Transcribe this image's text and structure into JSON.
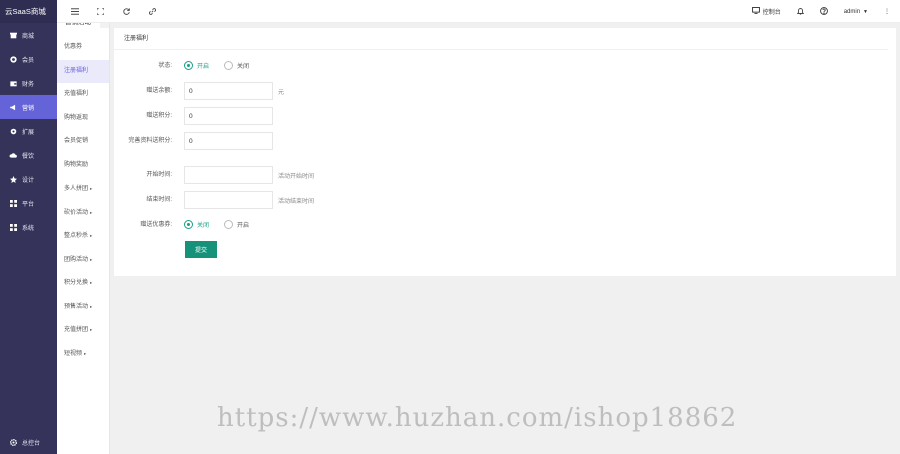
{
  "brand": "云SaaS商城",
  "sidebar": {
    "items": [
      {
        "label": "商城",
        "icon": "shop-icon"
      },
      {
        "label": "会员",
        "icon": "member-icon"
      },
      {
        "label": "财务",
        "icon": "wallet-icon"
      },
      {
        "label": "营销",
        "icon": "megaphone-icon"
      },
      {
        "label": "扩展",
        "icon": "puzzle-icon"
      },
      {
        "label": "餐饮",
        "icon": "cloud-icon"
      },
      {
        "label": "设计",
        "icon": "brush-icon"
      },
      {
        "label": "平台",
        "icon": "grid-icon"
      },
      {
        "label": "系统",
        "icon": "grid-icon"
      }
    ],
    "bottom": {
      "label": "总控台",
      "icon": "gear-icon"
    }
  },
  "submenu": {
    "title": "营销活动",
    "collapse": "«",
    "items": [
      {
        "label": "优惠券",
        "arrow": ""
      },
      {
        "label": "注册福利",
        "arrow": ""
      },
      {
        "label": "充值福利",
        "arrow": ""
      },
      {
        "label": "购物返现",
        "arrow": ""
      },
      {
        "label": "会员促销",
        "arrow": ""
      },
      {
        "label": "购物奖励",
        "arrow": ""
      },
      {
        "label": "多人拼团",
        "arrow": "▸"
      },
      {
        "label": "砍价活动",
        "arrow": "▸"
      },
      {
        "label": "整点秒杀",
        "arrow": "▸"
      },
      {
        "label": "团购活动",
        "arrow": "▸"
      },
      {
        "label": "积分兑换",
        "arrow": "▸"
      },
      {
        "label": "预售活动",
        "arrow": "▸"
      },
      {
        "label": "充值拼团",
        "arrow": "▸"
      },
      {
        "label": "短视频",
        "arrow": "▸"
      }
    ]
  },
  "topbar": {
    "console_label": "控制台",
    "user": "admin",
    "user_caret": "▼",
    "more": "⋮"
  },
  "form": {
    "title": "注册福利",
    "status": {
      "label": "状态:",
      "options": [
        "开启",
        "关闭"
      ],
      "selected": 0
    },
    "balance": {
      "label": "赠送余额:",
      "value": "0",
      "suffix": "元"
    },
    "points": {
      "label": "赠送积分:",
      "value": "0"
    },
    "profile_points": {
      "label": "完善资料送积分:",
      "value": "0"
    },
    "start_time": {
      "label": "开始时间:",
      "value": "",
      "hint": "活动开始时间"
    },
    "end_time": {
      "label": "结束时间:",
      "value": "",
      "hint": "活动结束时间"
    },
    "coupon": {
      "label": "赠送优惠券:",
      "options": [
        "关闭",
        "开启"
      ],
      "selected": 0
    },
    "submit_label": "提交"
  },
  "watermark": "https://www.huzhan.com/ishop18862",
  "colors": {
    "sidebar": "#35335a",
    "accent": "#6563d8",
    "primary": "#16917a"
  }
}
